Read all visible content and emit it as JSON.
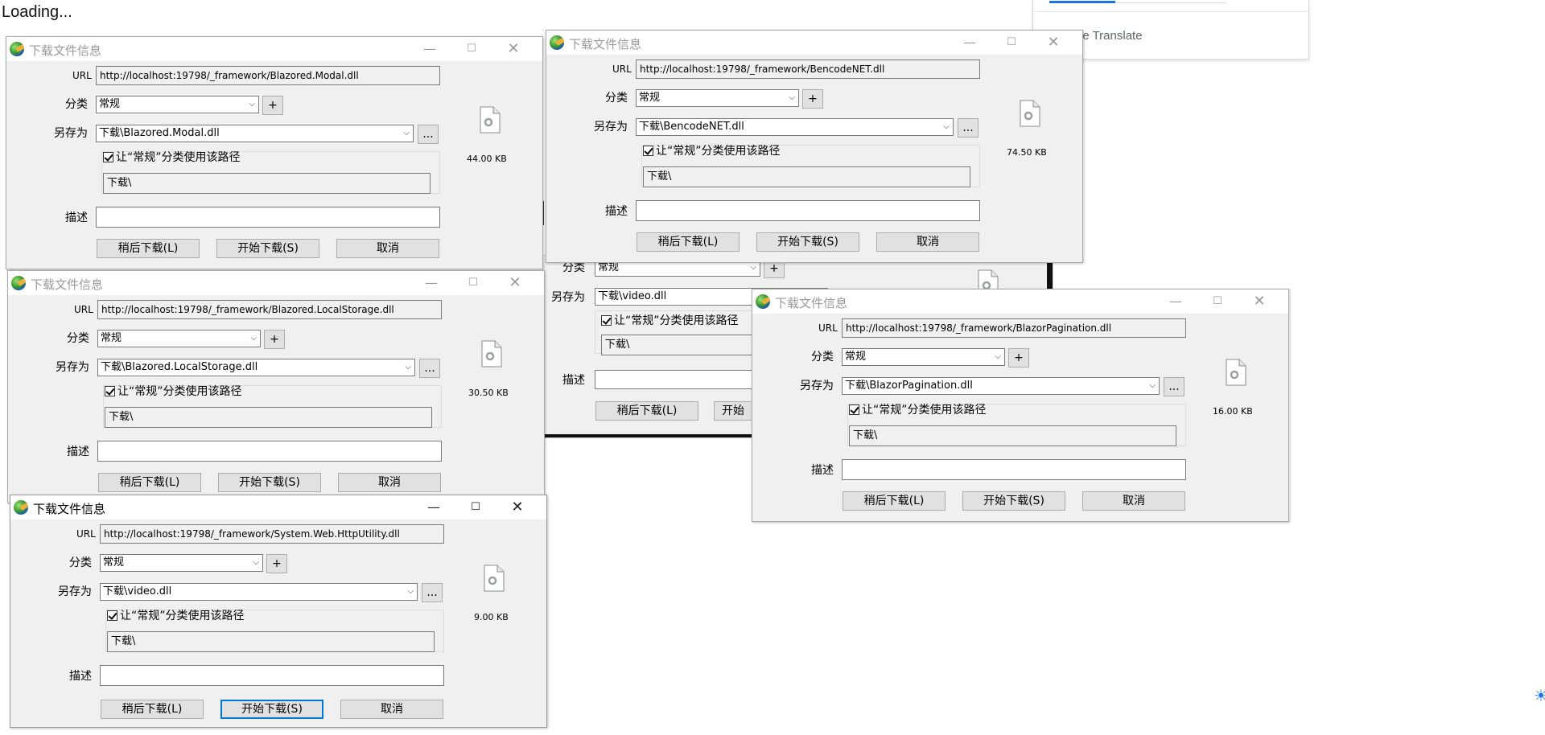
{
  "page": {
    "loading_text": "Loading..."
  },
  "translate_panel": {
    "text": "le Translate"
  },
  "common": {
    "dialog_title": "下载文件信息",
    "label_url": "URL",
    "label_category": "分类",
    "label_save_as": "另存为",
    "label_description": "描述",
    "checkbox_label": "让“常规”分类使用该路径",
    "path_value": "下载\\",
    "category_value": "常规",
    "button_later": "稍后下载(L)",
    "button_start": "开始下载(S)",
    "button_cancel": "取消",
    "add_label": "+",
    "browse_label": "...",
    "minimize_glyph": "—",
    "maximize_glyph": "☐",
    "close_glyph": "✕"
  },
  "ghost_dialog": {
    "category_value": "常规",
    "save_as_value": "下载\\video.dll",
    "path_value": "下载\\",
    "button_later": "稍后下载(L)",
    "button_start_partial": "开始"
  },
  "dialogs": [
    {
      "url": "http://localhost:19798/_framework/Blazored.Modal.dll",
      "save_as": "下载\\Blazored.Modal.dll",
      "size": "44.00  KB"
    },
    {
      "url": "http://localhost:19798/_framework/BencodeNET.dll",
      "save_as": "下载\\BencodeNET.dll",
      "size": "74.50  KB"
    },
    {
      "url": "http://localhost:19798/_framework/Blazored.LocalStorage.dll",
      "save_as": "下载\\Blazored.LocalStorage.dll",
      "size": "30.50  KB"
    },
    {
      "url": "http://localhost:19798/_framework/BlazorPagination.dll",
      "save_as": "下载\\BlazorPagination.dll",
      "size": "16.00  KB"
    },
    {
      "url": "http://localhost:19798/_framework/System.Web.HttpUtility.dll",
      "save_as": "下载\\video.dll",
      "size": "9.00  KB"
    }
  ],
  "colors": {
    "active_focus": "#0078d7",
    "dialog_bg": "#f0f0f0"
  },
  "icons": [
    "app-logo-icon",
    "file-gear-icon",
    "checkbox-checked-icon",
    "minimize-icon",
    "maximize-icon",
    "close-icon",
    "dropdown-arrow-icon"
  ]
}
